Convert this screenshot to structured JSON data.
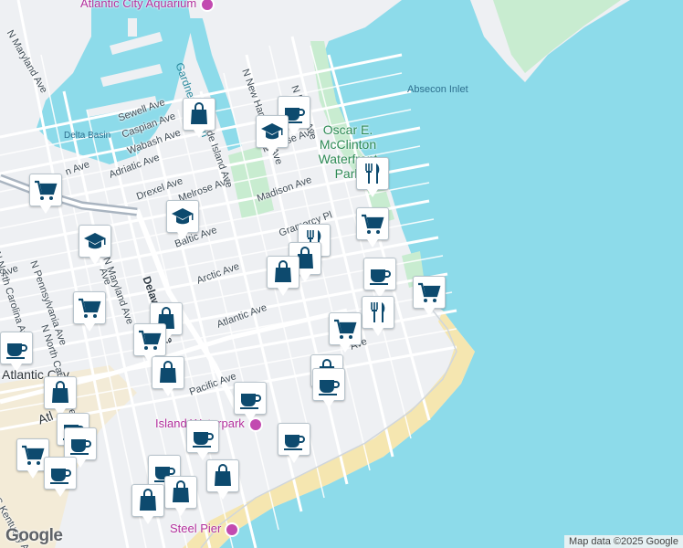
{
  "map": {
    "attribution": "Map data ©2025 Google",
    "logo": "Google",
    "water_color": "#8ddbea",
    "land_color": "#eef0f3",
    "park_color": "#c8ecd0",
    "beach_color": "#f5e6b0",
    "marker_color": "#0d4a6e"
  },
  "labels": {
    "aquarium": "Atlantic City Aquarium",
    "absecon_inlet": "Absecon Inlet",
    "delta_basin": "Delta Basin",
    "gardners_basin": "Gardner's Basin",
    "park": "Oscar E. McClinton Waterfront Park",
    "island_waterpark": "Island Waterpark",
    "steel_pier": "Steel Pier",
    "atlantic_city": "Atlantic City",
    "n_maryland_ave_top": "N Maryland Ave",
    "sewell_ave": "Sewell Ave",
    "caspian_ave": "Caspian Ave",
    "wabash_ave": "Wabash Ave",
    "adriatic_ave": "Adriatic Ave",
    "drexel_ave": "Drexel Ave",
    "melrose_ave_w": "Melrose Ave",
    "melrose_ave_e": "Melrose Ave",
    "n_rhode_island_ave": "N Rhode Island Ave",
    "n_new_hampshire_ave": "N New Hampshire Ave",
    "n_maine_ave": "N Maine Ave",
    "madison_ave": "Madison Ave",
    "gramercy_pl": "Gramercy Pl",
    "baltic_ave": "Baltic Ave",
    "arctic_ave": "Arctic Ave",
    "atlantic_ave": "Atlantic Ave",
    "pacific_ave": "Pacific Ave",
    "delaware_ave": "Delaware Ave",
    "n_maryland_ave_mid": "N Maryland Ave",
    "n_pennsylvania_ave": "N Pennsylvania Ave",
    "n_north_carolina_ave": "N North Carolina Ave",
    "n_north_carolina_ave_2": "N North Carolina Ave",
    "s_kentucky_ave": "S Kentucky Ave",
    "ave_partial_1": "Ave",
    "ave_partial_2": "Ave",
    "ave_partial_3": "Ave",
    "n_ave_partial": "n Ave",
    "atl_partial": "Atl"
  },
  "markers": [
    {
      "type": "shopping",
      "icon": "shopping-bag-icon"
    },
    {
      "type": "cafe",
      "icon": "coffee-cup-icon"
    },
    {
      "type": "school",
      "icon": "graduation-cap-icon"
    },
    {
      "type": "grocery",
      "icon": "shopping-cart-icon"
    },
    {
      "type": "restaurant",
      "icon": "fork-knife-icon"
    },
    {
      "type": "grocery",
      "icon": "shopping-cart-icon"
    },
    {
      "type": "school",
      "icon": "graduation-cap-icon"
    },
    {
      "type": "school",
      "icon": "graduation-cap-icon"
    },
    {
      "type": "restaurant",
      "icon": "fork-knife-icon"
    },
    {
      "type": "shopping",
      "icon": "shopping-bag-icon"
    },
    {
      "type": "shopping",
      "icon": "shopping-bag-icon"
    },
    {
      "type": "cafe",
      "icon": "coffee-cup-icon"
    },
    {
      "type": "grocery",
      "icon": "shopping-cart-icon"
    },
    {
      "type": "grocery",
      "icon": "shopping-cart-icon"
    },
    {
      "type": "restaurant",
      "icon": "fork-knife-icon"
    },
    {
      "type": "shopping",
      "icon": "shopping-bag-icon"
    },
    {
      "type": "grocery",
      "icon": "shopping-cart-icon"
    },
    {
      "type": "grocery",
      "icon": "shopping-cart-icon"
    },
    {
      "type": "cafe",
      "icon": "coffee-cup-icon"
    },
    {
      "type": "shopping",
      "icon": "shopping-bag-icon"
    },
    {
      "type": "shopping",
      "icon": "shopping-bag-icon"
    },
    {
      "type": "shopping",
      "icon": "shopping-bag-icon"
    },
    {
      "type": "cafe",
      "icon": "coffee-cup-icon"
    },
    {
      "type": "cafe",
      "icon": "coffee-cup-icon"
    },
    {
      "type": "cafe",
      "icon": "coffee-cup-icon"
    },
    {
      "type": "cafe",
      "icon": "coffee-cup-icon"
    },
    {
      "type": "cafe",
      "icon": "coffee-cup-icon"
    },
    {
      "type": "grocery",
      "icon": "shopping-cart-icon"
    },
    {
      "type": "cafe",
      "icon": "coffee-cup-icon"
    },
    {
      "type": "cafe",
      "icon": "coffee-cup-icon"
    },
    {
      "type": "shopping",
      "icon": "shopping-bag-icon"
    },
    {
      "type": "shopping",
      "icon": "shopping-bag-icon"
    },
    {
      "type": "shopping",
      "icon": "shopping-bag-icon"
    },
    {
      "type": "cafe",
      "icon": "coffee-cup-icon"
    }
  ]
}
